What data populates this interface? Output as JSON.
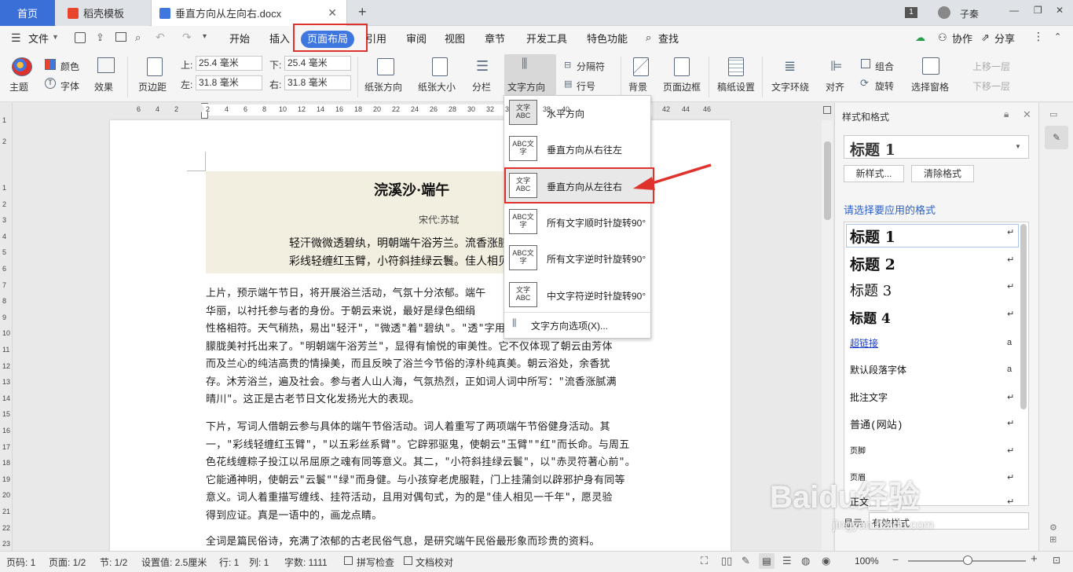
{
  "tabs": {
    "home": "首页",
    "templates": "稻壳模板",
    "document": "垂直方向从左向右.docx",
    "new_tab": "+",
    "page_count_badge": "1",
    "user": "子秦"
  },
  "menu": {
    "file": "文件",
    "items": [
      "开始",
      "插入",
      "页面布局",
      "引用",
      "审阅",
      "视图",
      "章节",
      "开发工具",
      "特色功能"
    ],
    "search": "查找",
    "collab": "协作",
    "share": "分享"
  },
  "ribbon": {
    "theme": "主题",
    "colors": "颜色",
    "font": "字体",
    "effects": "效果",
    "margins": "页边距",
    "top_label": "上:",
    "top_value": "25.4 毫米",
    "bottom_label": "下:",
    "bottom_value": "25.4 毫米",
    "left_label": "左:",
    "left_value": "31.8 毫米",
    "right_label": "右:",
    "right_value": "31.8 毫米",
    "orientation": "纸张方向",
    "size": "纸张大小",
    "columns": "分栏",
    "text_direction": "文字方向",
    "breaks": "分隔符",
    "line_numbers": "行号",
    "background": "背景",
    "page_border": "页面边框",
    "manuscript": "稿纸设置",
    "wrap": "文字环绕",
    "align": "对齐",
    "group": "组合",
    "rotate": "旋转",
    "selection_pane": "选择窗格",
    "bring_forward": "上移一层",
    "send_backward": "下移一层"
  },
  "ruler_h": [
    "6",
    "4",
    "2",
    "2",
    "4",
    "6",
    "8",
    "10",
    "12",
    "14",
    "16",
    "18",
    "20",
    "22",
    "24",
    "26",
    "28",
    "30",
    "32",
    "34",
    "36",
    "38",
    "40",
    "42",
    "44",
    "46"
  ],
  "ruler_v": [
    "1",
    "2",
    "1",
    "2",
    "3",
    "4",
    "5",
    "6",
    "7",
    "8",
    "9",
    "10",
    "11",
    "12",
    "13",
    "14",
    "15",
    "16",
    "17",
    "18",
    "19",
    "20",
    "21",
    "22",
    "23"
  ],
  "document": {
    "title": "浣溪沙·端午",
    "author": "宋代:苏轼",
    "poem_line1": "轻汗微微透碧纨，明朝端午浴芳兰。流香涨腻",
    "poem_line2": "彩线轻缠红玉臂，小符斜挂绿云鬟。佳人相见",
    "p1": [
      "上片，预示端午节日，将开展浴兰活动，气氛十分浓郁。端午",
      "华丽，以衬托参与者的身份。于朝云来说，最好是绿色细绢",
      "性格相符。天气稍热，易出\"轻汗\"，\"微透\"着\"碧纨\"。\"透\"字用",
      "朦胧美衬托出来了。\"明朝端午浴芳兰\"，显得有愉悦的审美性。它不仅体现了朝云由芳体",
      "而及兰心的纯洁高贵的情操美，而且反映了浴兰今节俗的淳朴纯真美。朝云浴处，余香犹",
      "存。沐芳浴兰，遍及社会。参与者人山人海，气氛热烈，正如词人词中所写：\"流香涨腻满",
      "晴川\"。这正是古老节日文化发扬光大的表现。"
    ],
    "p2": [
      "下片，写词人借朝云参与具体的端午节俗活动。词人着重写了两项端午节俗健身活动。其",
      "一，\"彩线轻缠红玉臂\"，\"以五彩丝系臂\"。它辟邪驱鬼，使朝云\"玉臂\"\"红\"而长命。与周五",
      "色花线缠粽子投江以吊屈原之魂有同等意义。其二，\"小符斜挂绿云鬟\"，以\"赤灵符著心前\"。",
      "它能通神明，使朝云\"云鬟\"\"绿\"而身健。与小孩穿老虎服鞋，门上挂蒲剑以辟邪护身有同等",
      "意义。词人着重描写缠线、挂符活动，且用对偶句式，为的是\"佳人相见一千年\"，愿灵验",
      "得到应证。真是一语中的，画龙点睛。"
    ],
    "p3": "全词是篇民俗诗，充满了浓郁的古老民俗气息，是研究端午民俗最形象而珍贵的资料。"
  },
  "dropdown": {
    "items": [
      {
        "label": "水平方向",
        "icon_text": "文字ABC"
      },
      {
        "label": "垂直方向从右往左",
        "icon_text": "ABC文字"
      },
      {
        "label": "垂直方向从左往右",
        "icon_text": "文字ABC"
      },
      {
        "label": "所有文字顺时针旋转90°",
        "icon_text": "ABC文字"
      },
      {
        "label": "所有文字逆时针旋转90°",
        "icon_text": "ABC文字"
      },
      {
        "label": "中文字符逆时针旋转90°",
        "icon_text": "文字ABC"
      }
    ],
    "options": "文字方向选项(X)..."
  },
  "styles_panel": {
    "title": "样式和格式",
    "current": "标题 1",
    "new_style": "新样式...",
    "clear_format": "清除格式",
    "prompt": "请选择要应用的格式",
    "list": [
      "标题 1",
      "标题 2",
      "标题 3",
      "标题 4",
      "超链接",
      "默认段落字体",
      "批注文字",
      "普通(网站)",
      "页脚",
      "页眉",
      "正文"
    ],
    "show_label": "显示:",
    "show_value": "有效样式"
  },
  "statusbar": {
    "page_num": "页码: 1",
    "pages": "页面: 1/2",
    "section": "节: 1/2",
    "setting": "设置值: 2.5厘米",
    "row": "行: 1",
    "col": "列: 1",
    "words": "字数: 1111",
    "spell": "拼写检查",
    "proof": "文档校对",
    "zoom": "100%"
  },
  "watermark": {
    "text": "Baidu经验",
    "url": "jingyan.baidu.com"
  },
  "colors": {
    "accent": "#3f77e0",
    "highlight": "#e0322c",
    "home_tab": "#3b6fd8"
  }
}
